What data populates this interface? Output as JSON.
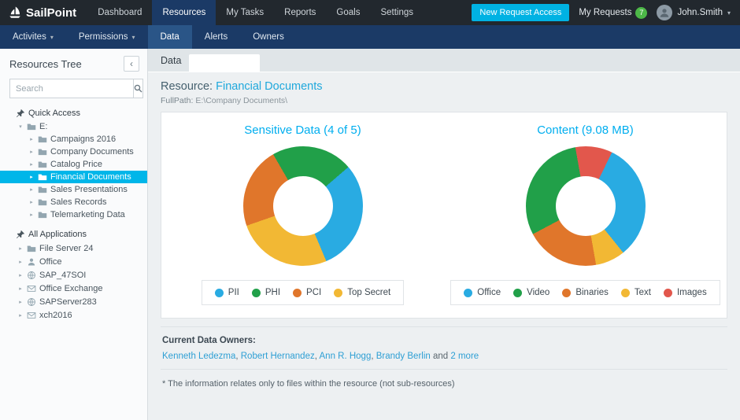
{
  "colors": {
    "accent_cyan": "#00b2e3",
    "nav_active_blue": "#1b3a66",
    "selected_tree": "#00b6e9",
    "badge_green": "#4db848",
    "chart_title": "#00aeef",
    "link": "#2e9fd4"
  },
  "topbar": {
    "brand": "SailPoint",
    "nav": [
      {
        "label": "Dashboard",
        "active": false
      },
      {
        "label": "Resources",
        "active": true
      },
      {
        "label": "My Tasks",
        "active": false
      },
      {
        "label": "Reports",
        "active": false
      },
      {
        "label": "Goals",
        "active": false
      },
      {
        "label": "Settings",
        "active": false
      }
    ],
    "request_button": "New Request Access",
    "my_requests_label": "My Requests",
    "requests_badge": "7",
    "user_name": "John.Smith"
  },
  "subnav": {
    "items": [
      {
        "label": "Activites",
        "dropdown": true,
        "active": false
      },
      {
        "label": "Permissions",
        "dropdown": true,
        "active": false
      },
      {
        "label": "Data",
        "dropdown": false,
        "active": true
      },
      {
        "label": "Alerts",
        "dropdown": false,
        "active": false
      },
      {
        "label": "Owners",
        "dropdown": false,
        "active": false
      }
    ]
  },
  "sidebar": {
    "title": "Resources Tree",
    "search_placeholder": "Search",
    "quick_access_label": "Quick Access",
    "drive_label": "E:",
    "folders": [
      "Campaigns 2016",
      "Company Documents",
      "Catalog Price",
      "Financial Documents",
      "Sales Presentations",
      "Sales Records",
      "Telemarketing Data"
    ],
    "selected_folder": "Financial Documents",
    "all_applications_label": "All Applications",
    "apps": [
      {
        "label": "File Server 24",
        "icon": "folder-icon"
      },
      {
        "label": "Office",
        "icon": "user-icon"
      },
      {
        "label": "SAP_47SOI",
        "icon": "globe-icon"
      },
      {
        "label": "Office Exchange",
        "icon": "mail-icon"
      },
      {
        "label": "SAPServer283",
        "icon": "globe-icon"
      },
      {
        "label": "xch2016",
        "icon": "mail-icon"
      }
    ]
  },
  "main": {
    "tab_label": "Data",
    "resource_label": "Resource:",
    "resource_name": "Financial Documents",
    "fullpath_label": "FullPath:",
    "fullpath_value": "E:\\Company Documents\\",
    "owners_title": "Current Data Owners:",
    "owners": [
      "Kenneth Ledezma",
      "Robert Hernandez",
      "Ann R. Hogg",
      "Brandy Berlin"
    ],
    "owners_and": "and",
    "owners_more": "2 more",
    "footnote": "* The information relates only to files within the resource (not sub-resources)"
  },
  "chart_data": [
    {
      "type": "pie",
      "donut": true,
      "title": "Sensitive Data (4 of 5)",
      "start_angle_deg": -30,
      "legend": [
        {
          "label": "PII",
          "color": "#29abe2"
        },
        {
          "label": "PHI",
          "color": "#21a049"
        },
        {
          "label": "PCI",
          "color": "#e0762b"
        },
        {
          "label": "Top Secret",
          "color": "#f2b834"
        }
      ],
      "segments": [
        {
          "label": "PHI",
          "value": 22,
          "color": "#21a049"
        },
        {
          "label": "PII",
          "value": 30,
          "color": "#29abe2"
        },
        {
          "label": "Top Secret",
          "value": 26,
          "color": "#f2b834"
        },
        {
          "label": "PCI",
          "value": 22,
          "color": "#e0762b"
        }
      ]
    },
    {
      "type": "pie",
      "donut": true,
      "title": "Content (9.08 MB)",
      "start_angle_deg": -10,
      "legend": [
        {
          "label": "Office",
          "color": "#29abe2"
        },
        {
          "label": "Video",
          "color": "#21a049"
        },
        {
          "label": "Binaries",
          "color": "#e0762b"
        },
        {
          "label": "Text",
          "color": "#f2b834"
        },
        {
          "label": "Images",
          "color": "#e2574c"
        }
      ],
      "segments": [
        {
          "label": "Images",
          "value": 10,
          "color": "#e2574c"
        },
        {
          "label": "Office",
          "value": 32,
          "color": "#29abe2"
        },
        {
          "label": "Text",
          "value": 8,
          "color": "#f2b834"
        },
        {
          "label": "Binaries",
          "value": 20,
          "color": "#e0762b"
        },
        {
          "label": "Video",
          "value": 30,
          "color": "#21a049"
        }
      ]
    }
  ]
}
